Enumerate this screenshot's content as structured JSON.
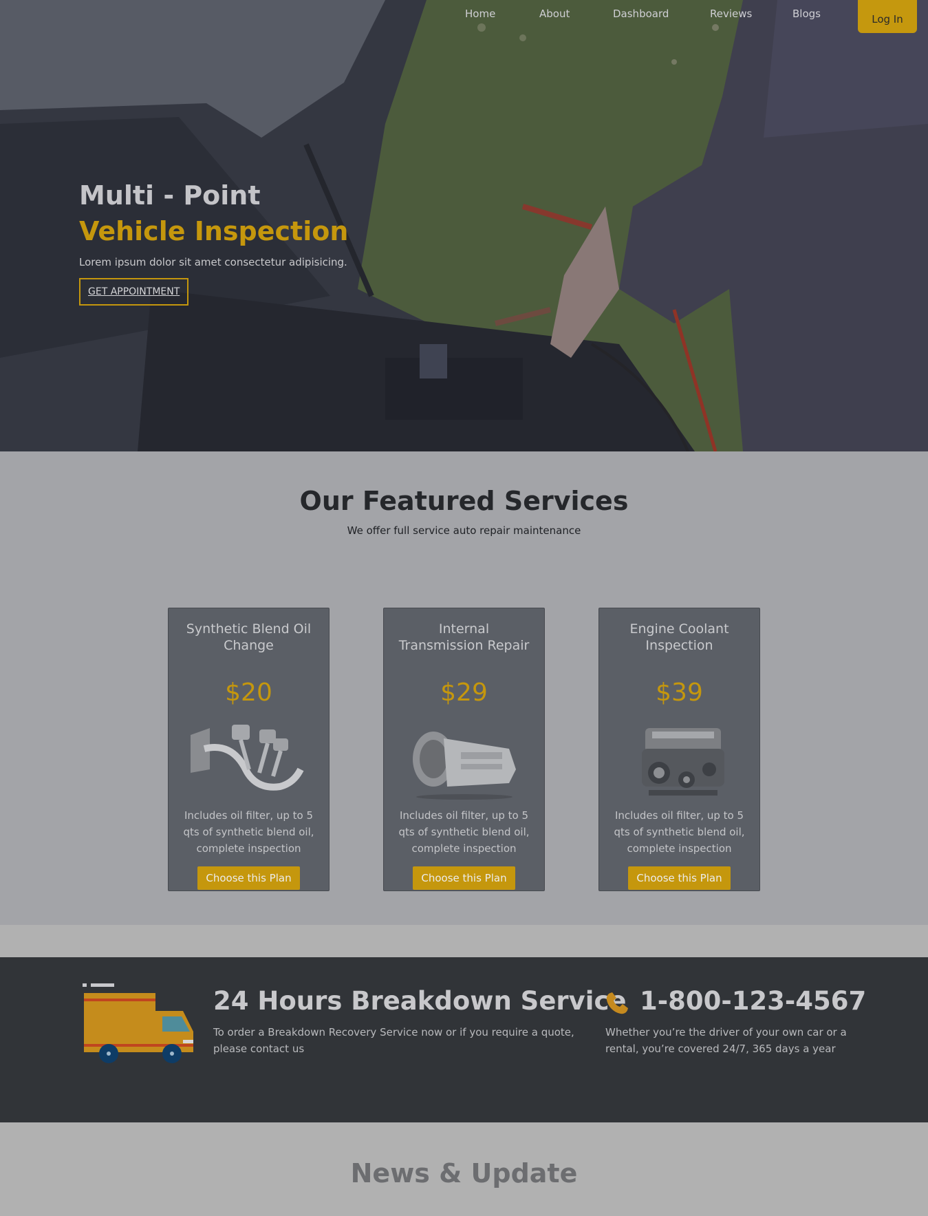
{
  "nav": {
    "items": [
      "Home",
      "About",
      "Dashboard",
      "Reviews",
      "Blogs"
    ],
    "login_label": "Log In"
  },
  "hero": {
    "title_line1": "Multi - Point",
    "title_line2": "Vehicle Inspection",
    "subtitle": "Lorem ipsum dolor sit amet consectetur adipisicing.",
    "cta_label": "GET APPOINTMENT"
  },
  "featured": {
    "title": "Our Featured Services",
    "subtitle": "We offer full service auto repair maintenance",
    "cards": [
      {
        "title": "Synthetic Blend Oil Change",
        "price": "$20",
        "image": "engine-pistons-oil",
        "description": "Includes oil filter, up to 5 qts of synthetic blend oil, complete inspection",
        "button": "Choose this Plan"
      },
      {
        "title": "Internal Transmission Repair",
        "price": "$29",
        "image": "transmission",
        "description": "Includes oil filter, up to 5 qts of synthetic blend oil, complete inspection",
        "button": "Choose this Plan"
      },
      {
        "title": "Engine Coolant Inspection",
        "price": "$39",
        "image": "engine-block",
        "description": "Includes oil filter, up to 5 qts of synthetic blend oil, complete inspection",
        "button": "Choose this Plan"
      }
    ]
  },
  "breakdown": {
    "title": "24 Hours Breakdown Service",
    "text": "To order a Breakdown Recovery Service now or if you require a quote, please contact us",
    "phone": "1-800-123-4567",
    "phone_text": "Whether you’re the driver of your own car or a rental, you’re covered 24/7, 365 days a year",
    "icons": {
      "truck": "truck-icon",
      "phone": "phone-icon"
    }
  },
  "news": {
    "title": "News & Update"
  },
  "colors": {
    "accent": "#c5970d",
    "dark_band": "#313438",
    "card": "#5b5f66"
  }
}
